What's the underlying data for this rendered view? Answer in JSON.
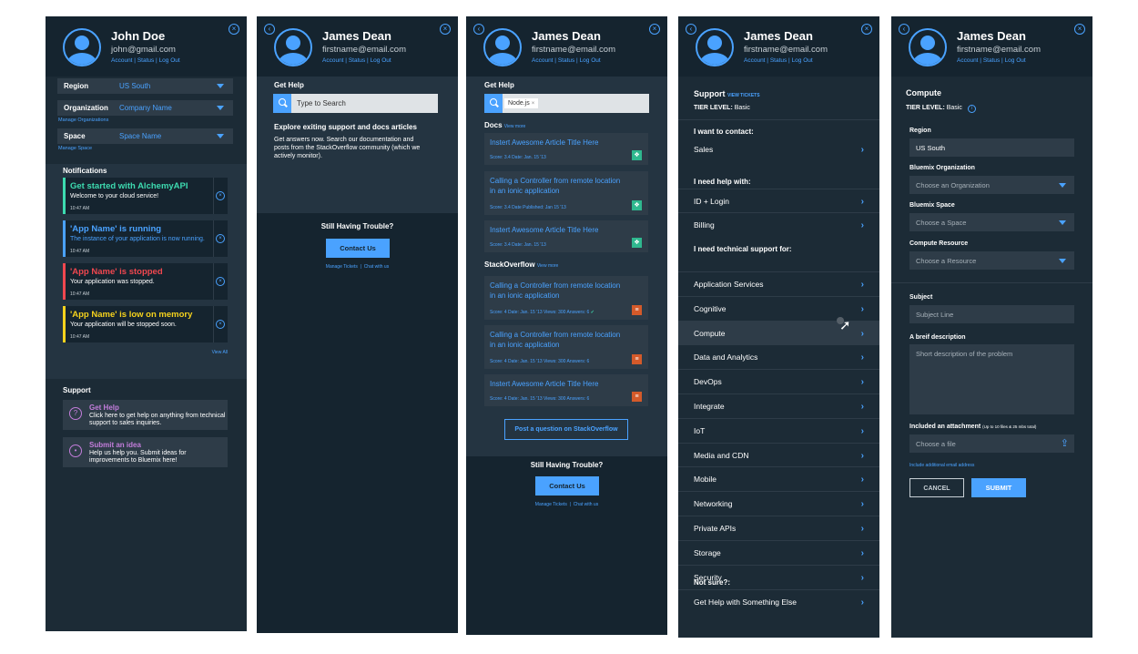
{
  "panel1": {
    "user": {
      "name": "John Doe",
      "email": "john@gmail.com"
    },
    "links": [
      "Account",
      "Status",
      "Log Out"
    ],
    "selectors": [
      {
        "label": "Region",
        "value": "US South"
      },
      {
        "label": "Organization",
        "value": "Company Name"
      },
      {
        "label": "Space",
        "value": "Space Name"
      }
    ],
    "manage_org": "Manage Organizations",
    "manage_space": "Manage Space",
    "notifications_title": "Notifications",
    "notifications": [
      {
        "title": "Get started with AlchemyAPI",
        "desc": "Welcome to your cloud service!",
        "time": "10:47 AM",
        "color": "#3ddbb0"
      },
      {
        "title": "'App Name' is running",
        "desc": "The instance of your application is now running.",
        "time": "10:47 AM",
        "color": "#4aa2ff"
      },
      {
        "title": "'App Name' is stopped",
        "desc": "Your application was stopped.",
        "time": "10:47 AM",
        "color": "#f0474f"
      },
      {
        "title": "'App Name' is low on memory",
        "desc": "Your application will be stopped soon.",
        "time": "10:47 AM",
        "color": "#f5d21d"
      }
    ],
    "view_all": "View All",
    "support_title": "Support",
    "support_cards": [
      {
        "title": "Get Help",
        "desc": "Click here to get help on anything from technical support to sales inquiries.",
        "icon": "?"
      },
      {
        "title": "Submit an idea",
        "desc": "Help us help you. Submit ideas for improvements to Bluemix here!",
        "icon": "•"
      }
    ]
  },
  "user2": {
    "name": "James Dean",
    "email": "firstname@email.com"
  },
  "panel2": {
    "title": "Get Help",
    "search_placeholder": "Type to Search",
    "explore_title": "Explore exiting support and docs articles",
    "explore_desc": "Get answers now. Search our documentation and posts from the StackOverflow community (which we actively monitor).",
    "trouble_title": "Still Having Trouble?",
    "contact_button": "Contact Us",
    "manage_tickets": "Manage Tickets",
    "chat": "Chat with us"
  },
  "panel3": {
    "title": "Get Help",
    "search_tag": "Node.js",
    "tag_remove": "×",
    "docs_title": "Docs",
    "docs_more": "View more",
    "docs": [
      {
        "title": "Instert Awesome Article Title Here",
        "meta": "Score: 3.4     Date: Jan. 15 '13"
      },
      {
        "title": "Calling a Controller from remote location in an ionic application",
        "meta": "Score: 3.4     Date Published: Jan 15 '13"
      },
      {
        "title": "Instert Awesome Article Title Here",
        "meta": "Score: 3.4     Date: Jan. 15 '13"
      }
    ],
    "so_title": "StackOverflow",
    "so_more": "View more",
    "so": [
      {
        "title": "Calling a Controller from remote location in an ionic application",
        "meta": "Score: 4     Date: Jan. 15 '13     Views: 300     Answers: 6",
        "check": "✓"
      },
      {
        "title": "Calling a Controller from remote location in an ionic application",
        "meta": "Score: 4     Date: Jan. 15 '13     Views: 300     Answers: 6"
      },
      {
        "title": "Instert Awesome Article Title Here",
        "meta": "Score: 4     Date: Jan. 15 '13     Views: 300     Answers: 6"
      }
    ],
    "post_button": "Post a question on StackOverflow",
    "trouble_title": "Still Having Trouble?",
    "contact_button": "Contact Us",
    "manage_tickets": "Manage Tickets",
    "chat": "Chat with us",
    "colors": {
      "docs_icon": "#2fb88f",
      "so_icon": "#d45a2a"
    }
  },
  "panel4": {
    "title": "Support",
    "view_tickets": "VIEW TICKETS",
    "tier_label": "TIER LEVEL:",
    "tier_value": "Basic",
    "contact_heading": "I want to contact:",
    "contact_items": [
      "Sales"
    ],
    "help_heading": "I need help with:",
    "help_items": [
      "ID + Login",
      "Billing"
    ],
    "tech_heading": "I need technical support for:",
    "tech_items": [
      "Application Services",
      "Cognitive",
      "Compute",
      "Data and Analytics",
      "DevOps",
      "Integrate",
      "IoT",
      "Media and CDN",
      "Mobile",
      "Networking",
      "Private APIs",
      "Storage",
      "Security"
    ],
    "selected_item": "Compute",
    "notsure_heading": "Not sure?:",
    "notsure_items": [
      "Get Help with Something Else"
    ]
  },
  "panel5": {
    "title": "Compute",
    "tier_label": "TIER LEVEL:",
    "tier_value": "Basic",
    "region_label": "Region",
    "region_value": "US South",
    "org_label": "Bluemix Organization",
    "org_placeholder": "Choose an Organization",
    "space_label": "Bluemix Space",
    "space_placeholder": "Choose a Space",
    "resource_label": "Compute Resource",
    "resource_placeholder": "Choose a Resource",
    "subject_label": "Subject",
    "subject_placeholder": "Subject Line",
    "desc_label": "A breif description",
    "desc_placeholder": "Short description of the problem",
    "attach_label": "Included an attachment",
    "attach_note": "(Up to 10 files & 25 mbs total)",
    "attach_placeholder": "Choose a file",
    "email_link": "Include additional email address",
    "cancel": "CANCEL",
    "submit": "SUBMIT"
  },
  "colors": {
    "panel_bg": "#1c2b36",
    "header_bg": "#15242f",
    "accent": "#4aa2ff",
    "card_bg": "#2e3c48",
    "purple": "#c37ddb"
  }
}
